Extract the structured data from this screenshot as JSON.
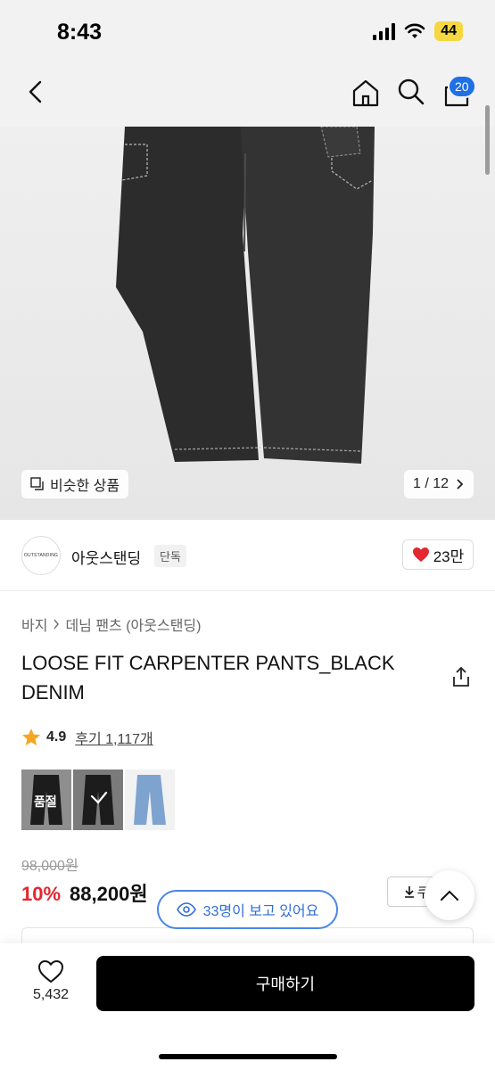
{
  "status_bar": {
    "time": "8:43",
    "battery": "44"
  },
  "header": {
    "cart_count": "20",
    "icons": [
      "back-icon",
      "home-icon",
      "search-icon",
      "cart-icon"
    ]
  },
  "hero": {
    "similar_label": "비슷한 상품",
    "page_indicator": "1 / 12"
  },
  "brand": {
    "logo_text": "OUTSTANDING",
    "name": "아웃스탠딩",
    "tag": "단독",
    "likes": "23만"
  },
  "breadcrumb": {
    "category": "바지",
    "subcategory": "데님 팬츠 (아웃스탠딩)"
  },
  "product": {
    "title": "LOOSE FIT CARPENTER PANTS_BLACK DENIM",
    "rating": "4.9",
    "reviews": "후기 1,117개",
    "variants": [
      {
        "label": "품절",
        "state": "soldout",
        "color": "#1c1c1c"
      },
      {
        "label": "",
        "state": "selected",
        "color": "#1c1c1c"
      },
      {
        "label": "",
        "state": "normal",
        "color": "#7fa3cf"
      }
    ],
    "original_price": "98,000원",
    "discount": "10%",
    "price": "88,200원",
    "coupon_label": "쿠"
  },
  "viewers": "33명이 보고 있어요",
  "bottom": {
    "favorite_count": "5,432",
    "buy_label": "구매하기"
  },
  "colors": {
    "accent_red": "#e3262f",
    "badge_blue": "#1f6fe5",
    "viewer_blue": "#2f6fd8"
  }
}
